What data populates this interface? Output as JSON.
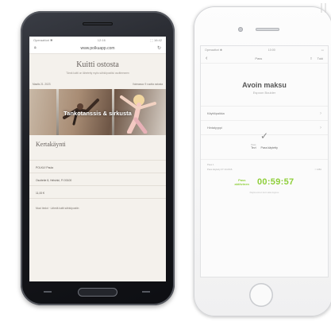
{
  "android": {
    "status": {
      "carrier": "Operaattori ✱",
      "time": "12:16",
      "battery": "⬚ 16:42"
    },
    "url": "www.polkuapp.com",
    "page_title": "Kuitti ostosta",
    "description": "Tämä kuitti on lähetetty myös sähköpostiisi osoitteeseen",
    "date": "Maalis 21. 2023",
    "validity": "Voimassa: 9 vuotta ostosta",
    "hero_text": "Tankotanssis & sirkusta",
    "section_title": "Kertakäynti",
    "fields": [
      {
        "label": "",
        "value": ""
      },
      {
        "label": "",
        "value": "POLKU! Paula"
      },
      {
        "label": "",
        "value": "Osoitetie 8, Helsinki, FI 00100"
      },
      {
        "label": "",
        "value": "11,00 €"
      }
    ],
    "footer": "Muut tiedot · Lähetä kuitti sähköpostiin"
  },
  "iphone": {
    "status": {
      "carrier": "Operaattori ✱",
      "time": "10:00",
      "battery": "▭"
    },
    "nav": {
      "back": "‹",
      "title": "Pass",
      "share_label": "Tuki"
    },
    "title": "Avoin maksu",
    "subtitle": "Espoon Boulder",
    "rows": [
      {
        "label": "Käyttöpaikka",
        "chevron": "›"
      },
      {
        "label": "Hintatyyppi",
        "chevron": "›"
      }
    ],
    "check": "✓",
    "type_left_small": "Pass",
    "type_left": "Tevi",
    "type_right": "Pass käytetty",
    "meta": [
      {
        "left": "Pass 1",
        "right": ""
      },
      {
        "left": "Pass käytetty 07.10.2016",
        "right": "≈ 1481"
      }
    ],
    "timer_label_line1": "Pass",
    "timer_label_line2": "aktiivinen",
    "timer": "00:59:57",
    "foot": "Käytä ennen kuin aika loppuu"
  }
}
